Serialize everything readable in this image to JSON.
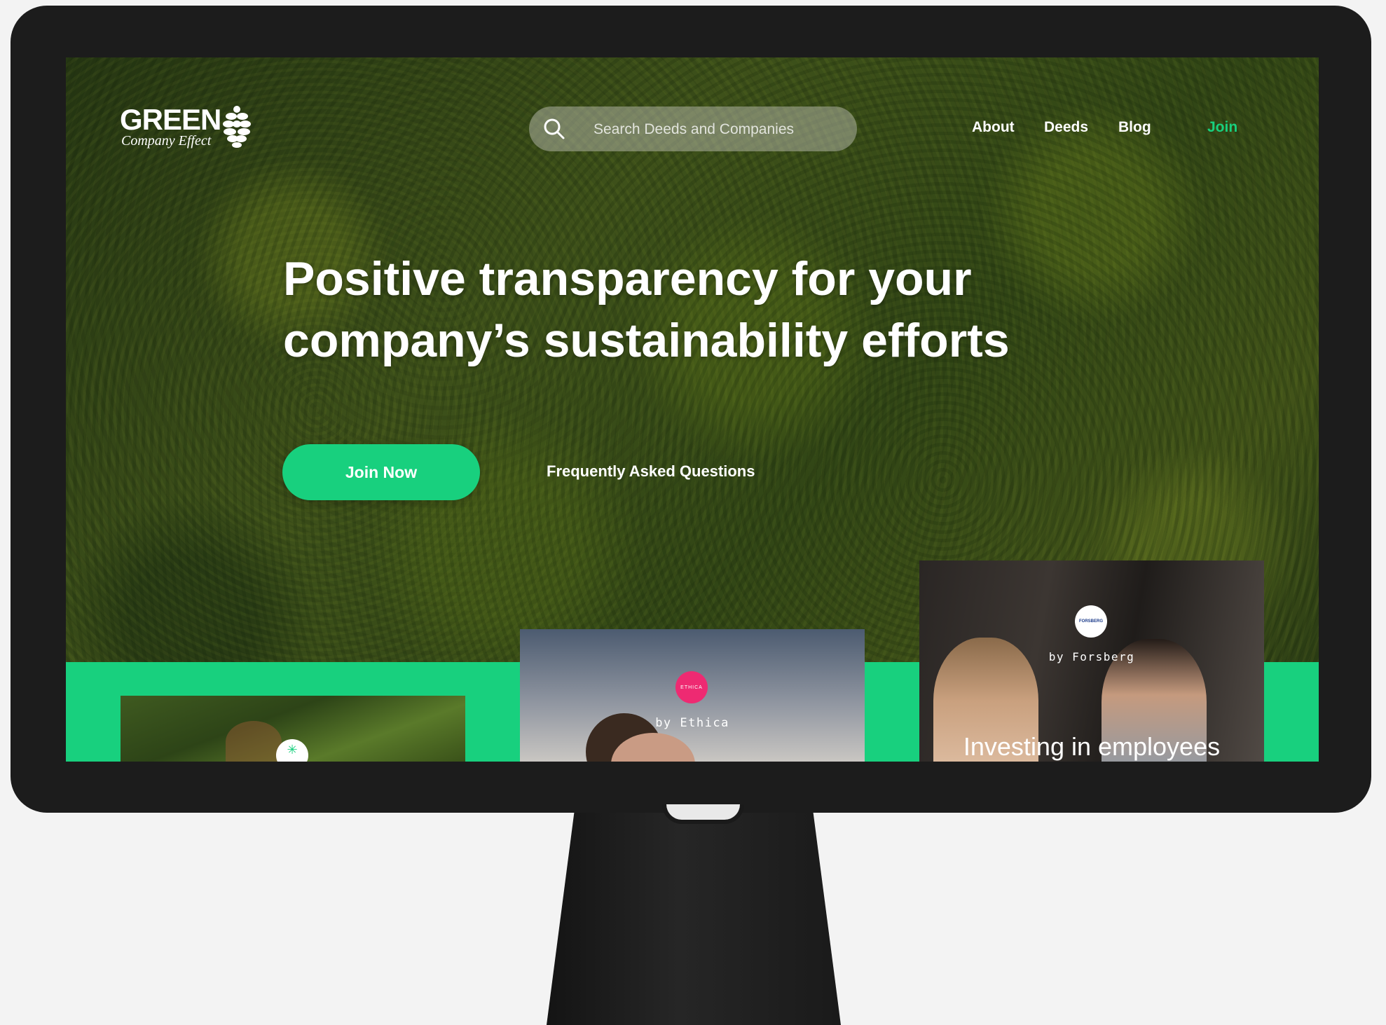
{
  "brand": {
    "name": "GREEN",
    "tagline": "Company Effect"
  },
  "search": {
    "placeholder": "Search Deeds and Companies"
  },
  "nav": {
    "items": [
      {
        "label": "About"
      },
      {
        "label": "Deeds"
      },
      {
        "label": "Blog"
      }
    ],
    "join_label": "Join"
  },
  "hero": {
    "headline_line1": "Positive transparency for your",
    "headline_line2": "company’s sustainability efforts",
    "join_now_label": "Join Now",
    "faq_label": "Frequently Asked Questions"
  },
  "cards": [
    {
      "by": "",
      "title": ""
    },
    {
      "by": "by Ethica",
      "logo_text": "ETHICA",
      "title": ""
    },
    {
      "by": "by Forsberg",
      "logo_text": "FORSBERG",
      "title": "Investing in employees"
    }
  ],
  "colors": {
    "accent": "#18d07e",
    "bezel": "#1c1c1c",
    "ethica_pink": "#ee2a72"
  }
}
